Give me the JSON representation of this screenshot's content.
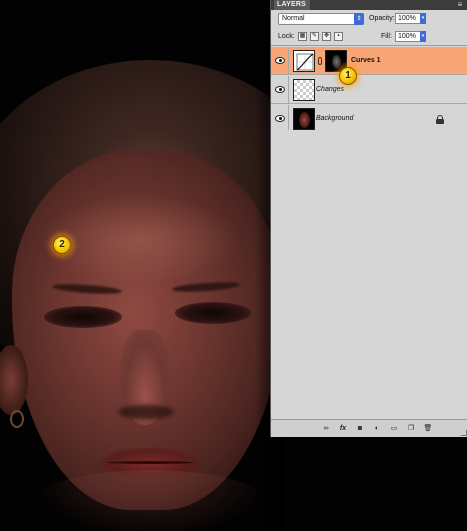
{
  "markers": [
    {
      "label": "1"
    },
    {
      "label": "2"
    }
  ],
  "panel": {
    "tab_label": "LAYERS",
    "menu_icon": "panel-menu-icon",
    "blend_mode": "Normal",
    "opacity_label": "Opacity:",
    "opacity_value": "100%",
    "lock_label": "Lock:",
    "fill_label": "Fill:",
    "fill_value": "100%",
    "layers": [
      {
        "name": "Curves 1",
        "selected": true,
        "thumb": "curves-adjustment-icon",
        "mask": true,
        "locked": false
      },
      {
        "name": "Changes",
        "selected": false,
        "thumb": "transparent-layer-thumbnail",
        "mask": false,
        "locked": false
      },
      {
        "name": "Background",
        "selected": false,
        "thumb": "photo-thumbnail",
        "mask": false,
        "locked": true
      }
    ],
    "bottom_buttons": [
      "link-layers-icon",
      "layer-style-icon",
      "add-mask-icon",
      "adjustment-layer-icon",
      "new-group-icon",
      "new-layer-icon",
      "delete-layer-icon"
    ]
  },
  "colors": {
    "selected_layer": "#f8a676",
    "panel_bg": "#d6d6d6",
    "marker": "#f5c400"
  }
}
